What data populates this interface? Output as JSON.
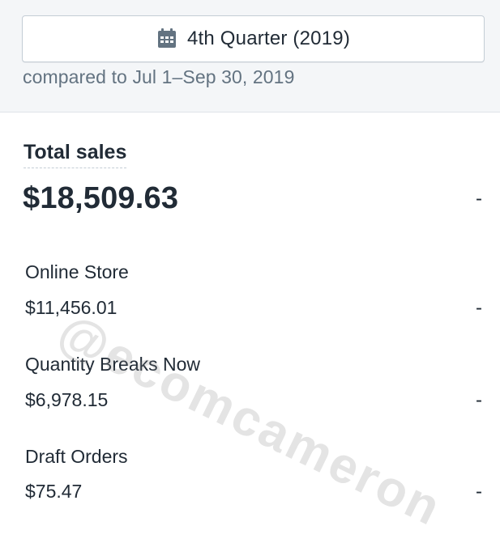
{
  "date_range": {
    "label": "4th Quarter (2019)",
    "icon": "calendar-icon",
    "compared_text": "compared to Jul 1–Sep 30, 2019"
  },
  "metric": {
    "title": "Total sales",
    "total_value": "$18,509.63",
    "total_change": "-"
  },
  "breakdown": [
    {
      "label": "Online Store",
      "value": "$11,456.01",
      "change": "-"
    },
    {
      "label": "Quantity Breaks Now",
      "value": "$6,978.15",
      "change": "-"
    },
    {
      "label": "Draft Orders",
      "value": "$75.47",
      "change": "-"
    }
  ],
  "watermark": "@ecomcameron",
  "colors": {
    "background_band": "#f4f6f8",
    "text_primary": "#212b36",
    "text_secondary": "#637381",
    "icon": "#637381"
  }
}
